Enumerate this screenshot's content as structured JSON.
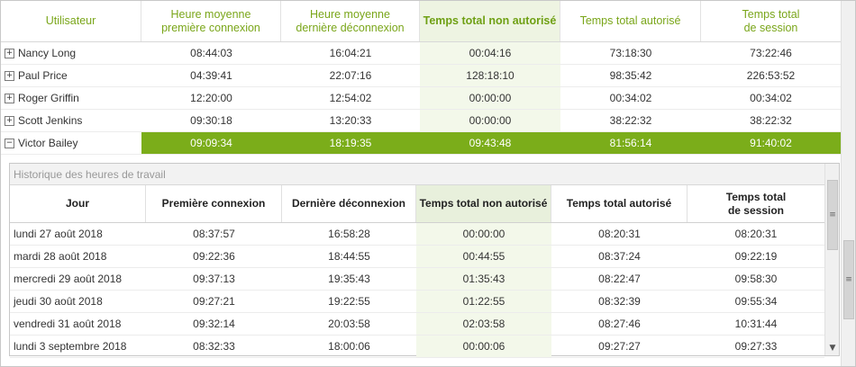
{
  "main_grid": {
    "columns": [
      "Utilisateur",
      "Heure moyenne\npremière connexion",
      "Heure moyenne\ndernière déconnexion",
      "Temps total non autorisé",
      "Temps total autorisé",
      "Temps total\nde session"
    ],
    "rows": [
      {
        "expander": "+",
        "user": "Nancy Long",
        "first": "08:44:03",
        "last": "16:04:21",
        "unauth": "00:04:16",
        "auth": "73:18:30",
        "session": "73:22:46"
      },
      {
        "expander": "+",
        "user": "Paul Price",
        "first": "04:39:41",
        "last": "22:07:16",
        "unauth": "128:18:10",
        "auth": "98:35:42",
        "session": "226:53:52"
      },
      {
        "expander": "+",
        "user": "Roger Griffin",
        "first": "12:20:00",
        "last": "12:54:02",
        "unauth": "00:00:00",
        "auth": "00:34:02",
        "session": "00:34:02"
      },
      {
        "expander": "+",
        "user": "Scott Jenkins",
        "first": "09:30:18",
        "last": "13:20:33",
        "unauth": "00:00:00",
        "auth": "38:22:32",
        "session": "38:22:32"
      },
      {
        "expander": "−",
        "user": "Victor Bailey",
        "first": "09:09:34",
        "last": "18:19:35",
        "unauth": "09:43:48",
        "auth": "81:56:14",
        "session": "91:40:02"
      }
    ]
  },
  "detail": {
    "caption": "Historique des heures de travail",
    "columns": [
      "Jour",
      "Première connexion",
      "Dernière déconnexion",
      "Temps total non autorisé",
      "Temps total autorisé",
      "Temps total\nde session"
    ],
    "rows": [
      {
        "day": "lundi 27 août 2018",
        "first": "08:37:57",
        "last": "16:58:28",
        "unauth": "00:00:00",
        "auth": "08:20:31",
        "session": "08:20:31"
      },
      {
        "day": "mardi 28 août 2018",
        "first": "09:22:36",
        "last": "18:44:55",
        "unauth": "00:44:55",
        "auth": "08:37:24",
        "session": "09:22:19"
      },
      {
        "day": "mercredi 29 août 2018",
        "first": "09:37:13",
        "last": "19:35:43",
        "unauth": "01:35:43",
        "auth": "08:22:47",
        "session": "09:58:30"
      },
      {
        "day": "jeudi 30 août 2018",
        "first": "09:27:21",
        "last": "19:22:55",
        "unauth": "01:22:55",
        "auth": "08:32:39",
        "session": "09:55:34"
      },
      {
        "day": "vendredi 31 août 2018",
        "first": "09:32:14",
        "last": "20:03:58",
        "unauth": "02:03:58",
        "auth": "08:27:46",
        "session": "10:31:44"
      },
      {
        "day": "lundi 3 septembre 2018",
        "first": "08:32:33",
        "last": "18:00:06",
        "unauth": "00:00:06",
        "auth": "09:27:27",
        "session": "09:27:33"
      }
    ]
  },
  "icons": {
    "expand": "plus-box-icon",
    "collapse": "minus-box-icon",
    "scroll_down": "chevron-down-icon",
    "scroll_grip": "grip-icon"
  },
  "colors": {
    "accent": "#7bad1a",
    "header_text": "#7aa61a",
    "selected_column_bg": "#eef4e2"
  }
}
